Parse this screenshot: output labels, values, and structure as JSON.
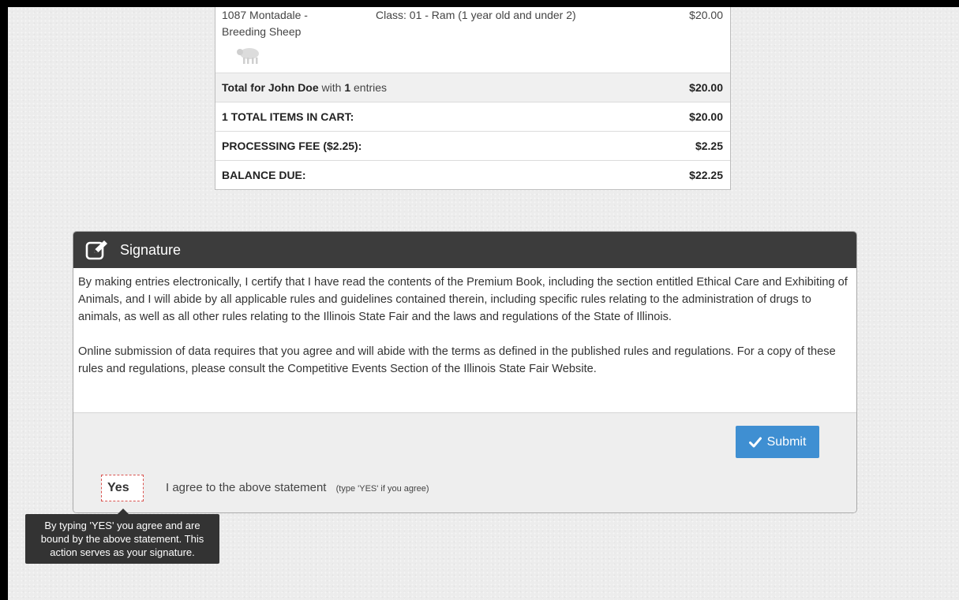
{
  "cart": {
    "item": {
      "name": "1087 Montadale - Breeding Sheep",
      "class": "Class: 01 - Ram (1 year old and under 2)",
      "price": "$20.00",
      "icon": "sheep-icon"
    },
    "total_row": {
      "prefix": "Total for",
      "exhibitor": "John Doe",
      "with": "with",
      "count": "1",
      "suffix": "entries",
      "amount": "$20.00"
    },
    "items_in_cart": {
      "label": "1 TOTAL ITEMS IN CART:",
      "amount": "$20.00"
    },
    "processing_fee": {
      "label": "PROCESSING FEE ($2.25):",
      "amount": "$2.25"
    },
    "balance_due": {
      "label": "BALANCE DUE:",
      "amount": "$22.25"
    }
  },
  "signature": {
    "title": "Signature",
    "icon": "edit-icon",
    "paragraph1": "By making entries electronically, I certify that I have read the contents of the Premium Book, including the section entitled Ethical Care and Exhibiting of Animals, and I will abide by all applicable rules and guidelines contained therein, including specific rules relating to the administration of drugs to animals, as well as all other rules relating to the Illinois State Fair and the laws and regulations of the State of Illinois.",
    "paragraph2": "Online submission of data requires that you agree and will abide with the terms as defined in the published rules and regulations. For a copy of these rules and regulations, please consult the Competitive Events Section of the Illinois State Fair Website.",
    "submit_label": "Submit",
    "agree_value": "Yes",
    "agree_label": "I agree to the above statement",
    "agree_hint": "(type 'YES' if you agree)",
    "tooltip": "By typing 'YES' you agree and are bound by the above statement. This action serves as your signature."
  },
  "colors": {
    "panel_header": "#3c3c3c",
    "submit_button": "#3f8fd2",
    "input_border": "#d9534f",
    "tooltip_bg": "#333333"
  }
}
